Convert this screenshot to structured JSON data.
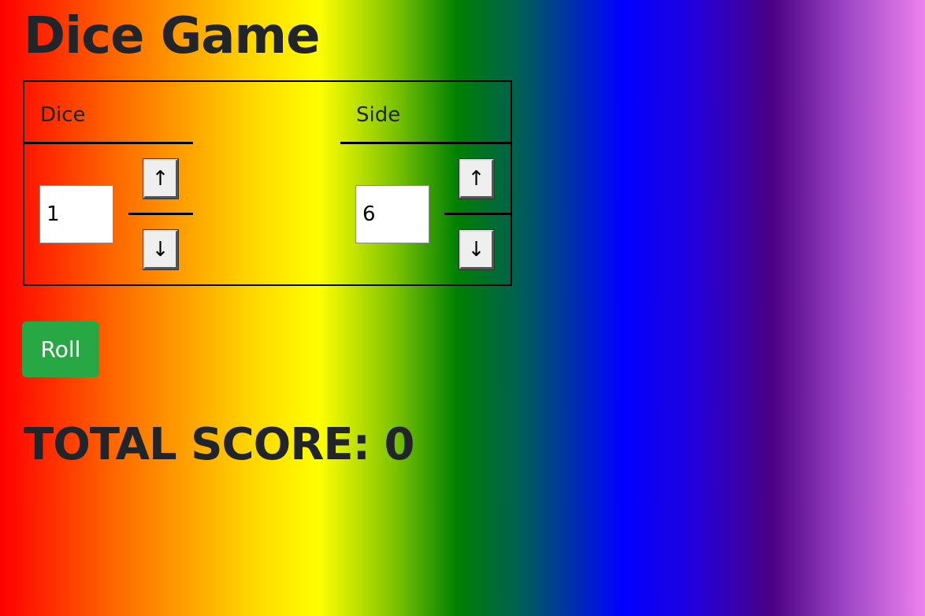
{
  "app": {
    "title": "Dice Game"
  },
  "table": {
    "dice_label": "Dice",
    "side_label": "Side"
  },
  "dice": {
    "value": "1",
    "up_label": "↑",
    "down_label": "↓"
  },
  "side": {
    "value": "6",
    "up_label": "↑",
    "down_label": "↓"
  },
  "actions": {
    "roll_label": "Roll"
  },
  "score": {
    "text": "TOTAL SCORE: 0"
  },
  "colors": {
    "roll_button": "#28a745",
    "text": "#212529",
    "background_gradient": [
      "#ff0000",
      "#ff6a00",
      "#ffd700",
      "#ffff00",
      "#7fc400",
      "#008000",
      "#005f55",
      "#0000ff",
      "#2200dd",
      "#4b0082",
      "#9a44c4",
      "#ee82ee"
    ]
  },
  "icons": {
    "increment": "arrow-up-icon",
    "decrement": "arrow-down-icon"
  }
}
